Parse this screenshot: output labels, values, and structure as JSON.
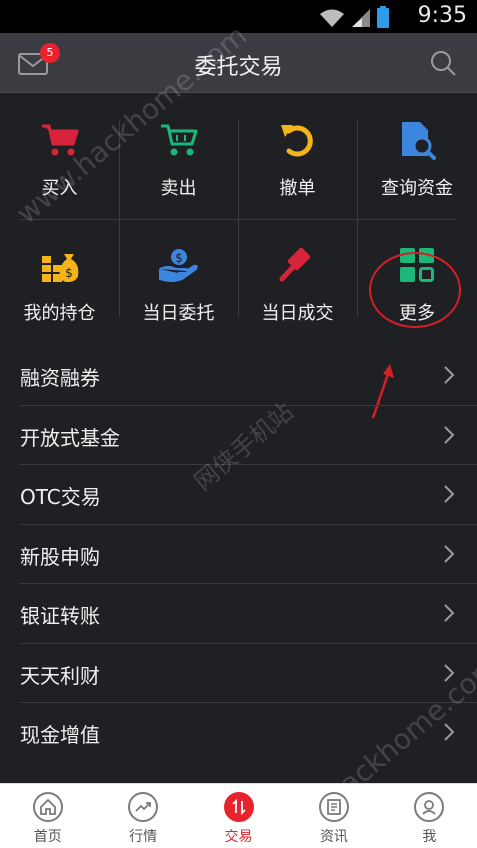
{
  "status_bar": {
    "time": "9:35"
  },
  "header": {
    "title": "委托交易",
    "mail_badge": "5"
  },
  "grid": [
    {
      "label": "买入",
      "icon": "cart-icon",
      "color": "#d8243a"
    },
    {
      "label": "卖出",
      "icon": "cart-icon",
      "color": "#1bb87a"
    },
    {
      "label": "撤单",
      "icon": "undo-icon",
      "color": "#f5b417"
    },
    {
      "label": "查询资金",
      "icon": "document-search-icon",
      "color": "#3d86e0"
    },
    {
      "label": "我的持仓",
      "icon": "money-bag-icon",
      "color": "#f5b417"
    },
    {
      "label": "当日委托",
      "icon": "hand-coin-icon",
      "color": "#3d86e0"
    },
    {
      "label": "当日成交",
      "icon": "gavel-icon",
      "color": "#d8243a"
    },
    {
      "label": "更多",
      "icon": "grid-more-icon",
      "color": "#1bb87a"
    }
  ],
  "menu": [
    {
      "label": "融资融券"
    },
    {
      "label": "开放式基金"
    },
    {
      "label": "OTC交易"
    },
    {
      "label": "新股申购"
    },
    {
      "label": "银证转账"
    },
    {
      "label": "天天利财"
    },
    {
      "label": "现金增值"
    }
  ],
  "watermarks": [
    "www.hackhome.com",
    "网侠手机站",
    "www.hackhome.com"
  ],
  "bottom_nav": [
    {
      "label": "首页",
      "icon": "home-icon",
      "active": false
    },
    {
      "label": "行情",
      "icon": "trend-icon",
      "active": false
    },
    {
      "label": "交易",
      "icon": "trade-arrows-icon",
      "active": true
    },
    {
      "label": "资讯",
      "icon": "news-icon",
      "active": false
    },
    {
      "label": "我",
      "icon": "user-icon",
      "active": false
    }
  ],
  "colors": {
    "accent": "#e8232d",
    "background": "#1f2024",
    "header": "#3b3c42"
  }
}
